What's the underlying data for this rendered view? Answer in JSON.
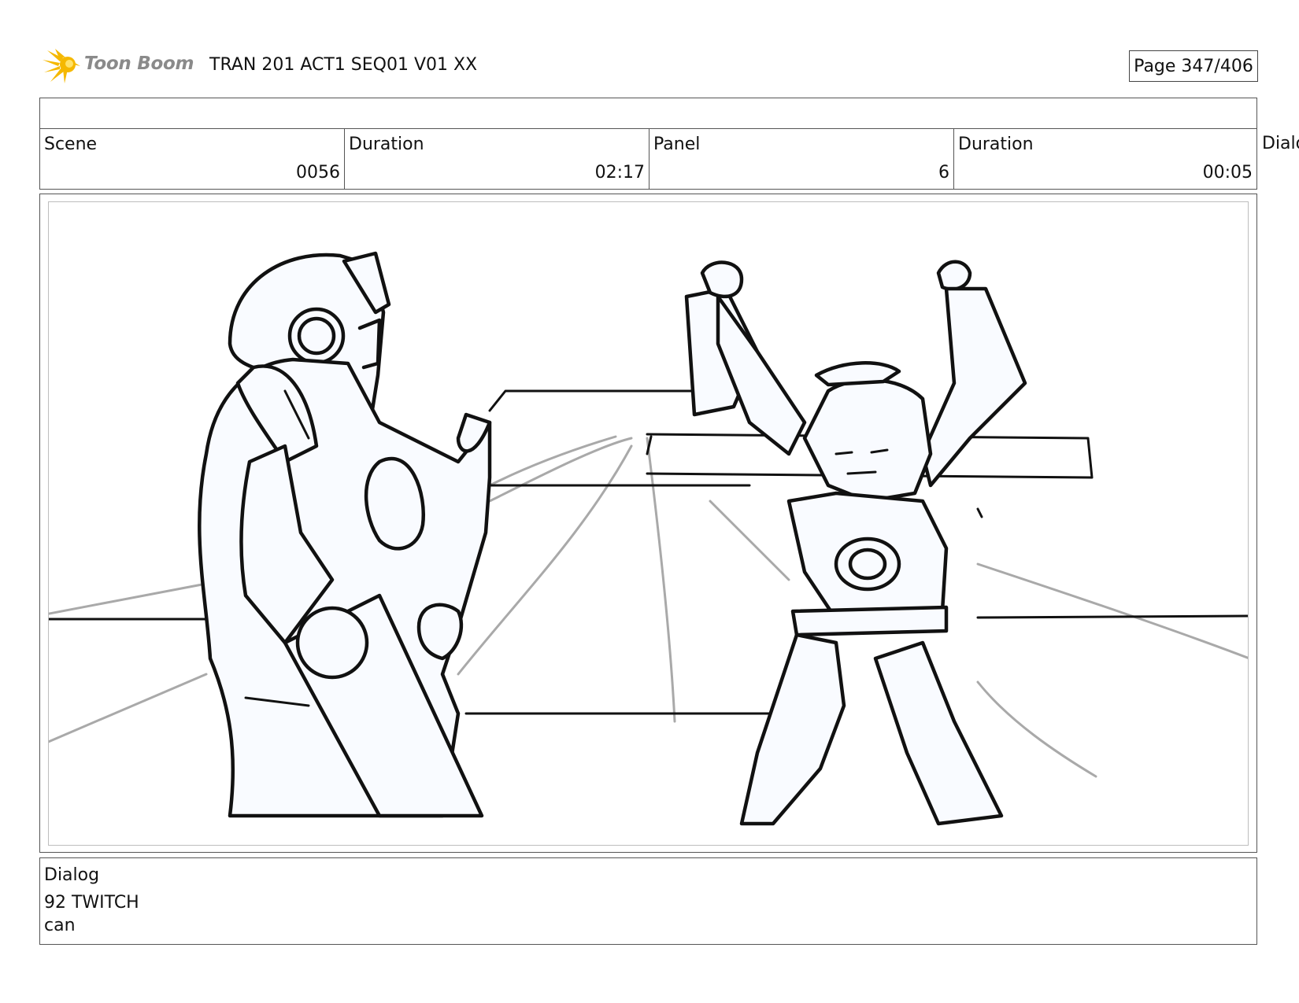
{
  "header": {
    "logo_text": "Toon Boom",
    "logo_icon": "sunburst-star-icon",
    "logo_color": "#f5b800",
    "doc_title": "TRAN 201 ACT1 SEQ01 V01 XX",
    "page": "Page 347/406"
  },
  "info": {
    "scene_label": "Scene",
    "scene_value": "0056",
    "scene_duration_label": "Duration",
    "scene_duration_value": "02:17",
    "panel_label": "Panel",
    "panel_value": "6",
    "panel_duration_label": "Duration",
    "panel_duration_value": "00:05",
    "overflow_label": "Dialo"
  },
  "panel": {
    "image": "storyboard-sketch",
    "description_icon": "two-robots-sketch"
  },
  "dialog": {
    "label": "Dialog",
    "line1": "92 TWITCH",
    "line2": "can"
  }
}
